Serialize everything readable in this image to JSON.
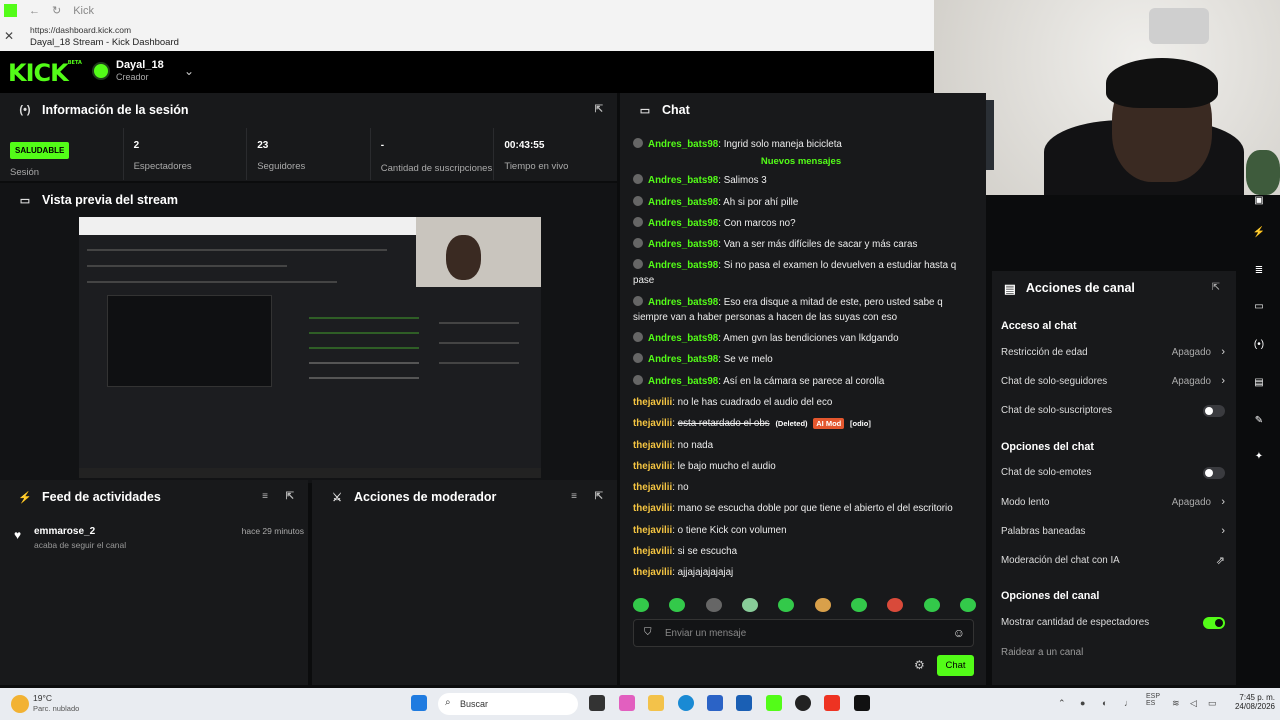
{
  "browser": {
    "tab_title": "Kick",
    "url": "https://dashboard.kick.com",
    "page_title": "Dayal_18 Stream - Kick Dashboard"
  },
  "header": {
    "logo": "KICK",
    "logo_badge": "BETA",
    "username": "Dayal_18",
    "role": "Creador"
  },
  "session": {
    "title": "Información de la sesión",
    "status_badge": "SALUDABLE",
    "status_label": "Sesión",
    "stats": [
      {
        "value": "2",
        "label": "Espectadores"
      },
      {
        "value": "23",
        "label": "Seguidores"
      },
      {
        "value": "-",
        "label": "Cantidad de suscripciones"
      },
      {
        "value": "00:43:55",
        "label": "Tiempo en vivo"
      }
    ]
  },
  "preview": {
    "title": "Vista previa del stream"
  },
  "feed": {
    "title": "Feed de actividades",
    "items": [
      {
        "user": "emmarose_2",
        "action": "acaba de seguir el canal",
        "time": "hace 29 minutos"
      }
    ]
  },
  "mod_actions": {
    "title": "Acciones de moderador"
  },
  "chat": {
    "title": "Chat",
    "new_messages": "Nuevos mensajes",
    "messages": [
      {
        "user": "Andres_bats98",
        "text": "Ingrid solo maneja bicicleta",
        "kind": "badge"
      },
      {
        "user": "Andres_bats98",
        "text": "Salimos 3",
        "kind": "badge"
      },
      {
        "user": "Andres_bats98",
        "text": "Ah si por ahí pille",
        "kind": "badge"
      },
      {
        "user": "Andres_bats98",
        "text": "Con marcos no?",
        "kind": "badge"
      },
      {
        "user": "Andres_bats98",
        "text": "Van a ser más difíciles de sacar y más caras",
        "kind": "badge"
      },
      {
        "user": "Andres_bats98",
        "text": "Si no pasa el examen lo devuelven a estudiar hasta q pase",
        "kind": "badge"
      },
      {
        "user": "Andres_bats98",
        "text": "Eso era disque a mitad de este, pero usted sabe q siempre van a haber personas a hacen de las suyas con eso",
        "kind": "badge"
      },
      {
        "user": "Andres_bats98",
        "text": "Amen gvn las bendiciones van lkdgando",
        "kind": "badge"
      },
      {
        "user": "Andres_bats98",
        "text": "Se ve melo",
        "kind": "badge"
      },
      {
        "user": "Andres_bats98",
        "text": "Así en la cámara se parece al corolla",
        "kind": "badge"
      },
      {
        "user": "thejavilii",
        "text": "no le has cuadrado el audio del eco",
        "kind": "owner"
      },
      {
        "user": "thejavilii",
        "text": "esta retardado el obs",
        "kind": "deleted",
        "deleted_label": "(Deleted)",
        "ai_label": "AI Mod",
        "reason": "[odio]"
      },
      {
        "user": "thejavilii",
        "text": "no nada",
        "kind": "owner"
      },
      {
        "user": "thejavilii",
        "text": "le bajo mucho el audio",
        "kind": "owner"
      },
      {
        "user": "thejavilii",
        "text": "no",
        "kind": "owner"
      },
      {
        "user": "thejavilii",
        "text": "mano se escucha doble por que tiene el abierto el del escritorio",
        "kind": "owner"
      },
      {
        "user": "thejavilii",
        "text": "o tiene Kick con volumen",
        "kind": "owner"
      },
      {
        "user": "thejavilii",
        "text": "si se escucha",
        "kind": "owner"
      },
      {
        "user": "thejavilii",
        "text": "ajjajajajajajaj",
        "kind": "owner"
      }
    ],
    "placeholder": "Enviar un mensaje",
    "send_label": "Chat"
  },
  "channel_actions": {
    "title": "Acciones de canal",
    "chat_access_title": "Acceso al chat",
    "age_restriction": {
      "label": "Restricción de edad",
      "value": "Apagado"
    },
    "followers_only": {
      "label": "Chat de solo-seguidores",
      "value": "Apagado"
    },
    "subs_only": {
      "label": "Chat de solo-suscriptores",
      "on": false
    },
    "chat_options_title": "Opciones del chat",
    "emotes_only": {
      "label": "Chat de solo-emotes",
      "on": false
    },
    "slow_mode": {
      "label": "Modo lento",
      "value": "Apagado"
    },
    "banned_words": {
      "label": "Palabras baneadas"
    },
    "ai_moderation": {
      "label": "Moderación del chat con IA"
    },
    "channel_options_title": "Opciones del canal",
    "show_viewer_count": {
      "label": "Mostrar cantidad de espectadores",
      "on": true
    },
    "raid": {
      "label": "Raidear a un canal"
    }
  },
  "taskbar": {
    "weather_temp": "19°C",
    "weather_text": "Parc. nublado",
    "search": "Buscar",
    "lang1": "ESP",
    "lang2": "ES",
    "time": "7:45 p. m.",
    "date": "24/08/2026"
  },
  "colors": {
    "accent": "#53fc18",
    "owner_name": "#f5c542",
    "panel_bg": "#18191b"
  }
}
